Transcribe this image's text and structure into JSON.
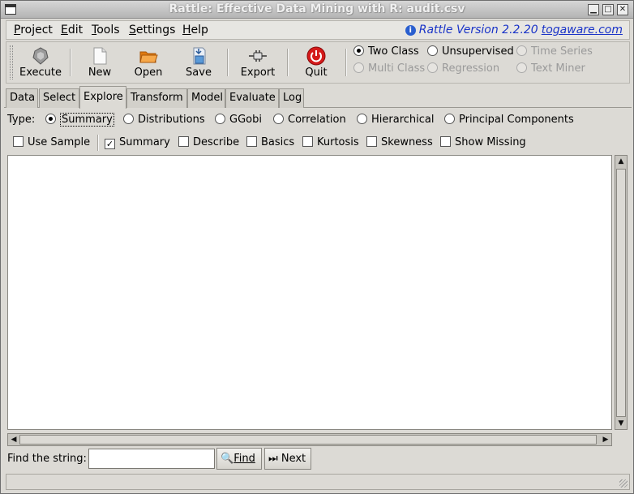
{
  "window": {
    "title": "Rattle: Effective Data Mining with R: audit.csv"
  },
  "menu": {
    "items": [
      {
        "label": "Project",
        "ul": "P",
        "rest": "roject"
      },
      {
        "label": "Edit",
        "ul": "E",
        "rest": "dit"
      },
      {
        "label": "Tools",
        "ul": "T",
        "rest": "ools"
      },
      {
        "label": "Settings",
        "ul": "S",
        "rest": "ettings"
      },
      {
        "label": "Help",
        "ul": "H",
        "rest": "elp"
      }
    ],
    "version_text": "Rattle Version 2.2.20",
    "version_link": "togaware.com"
  },
  "toolbar": {
    "execute": "Execute",
    "new": "New",
    "open": "Open",
    "save": "Save",
    "export": "Export",
    "quit": "Quit"
  },
  "mode": {
    "two_class": "Two Class",
    "unsupervised": "Unsupervised",
    "time_series": "Time Series",
    "multi_class": "Multi Class",
    "regression": "Regression",
    "text_miner": "Text Miner",
    "selected": "Two Class"
  },
  "tabs": [
    "Data",
    "Select",
    "Explore",
    "Transform",
    "Model",
    "Evaluate",
    "Log"
  ],
  "active_tab": "Explore",
  "explore": {
    "type_label": "Type:",
    "types": [
      "Summary",
      "Distributions",
      "GGobi",
      "Correlation",
      "Hierarchical",
      "Principal Components"
    ],
    "selected_type": "Summary",
    "options": {
      "use_sample": "Use Sample",
      "summary": "Summary",
      "describe": "Describe",
      "basics": "Basics",
      "kurtosis": "Kurtosis",
      "skewness": "Skewness",
      "show_missing": "Show Missing"
    },
    "checked": [
      "Summary"
    ]
  },
  "find": {
    "label": "Find the string:",
    "value": "",
    "find_button": "Find",
    "next_button": "Next"
  },
  "colors": {
    "link": "#1a34c8",
    "quit": "#d41a1a",
    "open": "#f08a1c"
  }
}
